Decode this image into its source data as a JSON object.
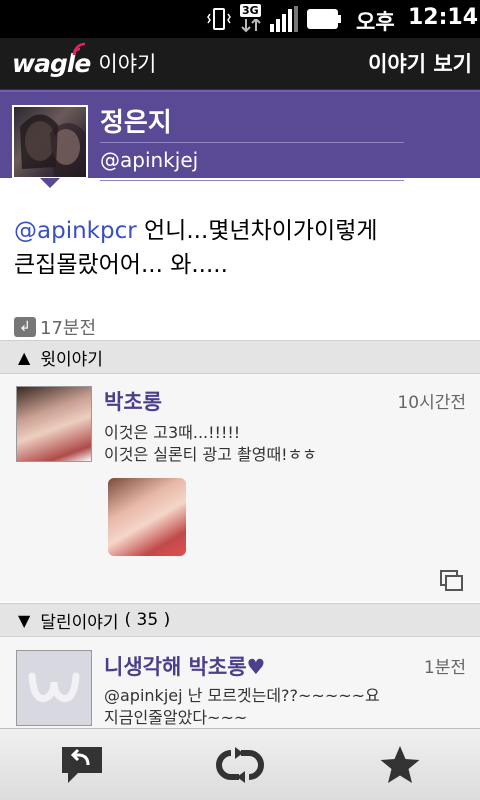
{
  "status_bar": {
    "network": "3G",
    "ampm": "오후",
    "time": "12:14"
  },
  "header": {
    "logo": "wagle",
    "logo_sub": "이야기",
    "action": "이야기 보기"
  },
  "profile": {
    "name": "정은지",
    "handle": "@apinkjej"
  },
  "post": {
    "mention": "@apinkpcr",
    "text_line1": " 언니...몇년차이가이렇게",
    "text_line2": "큰집몰랐어어... 와.....",
    "time": "17분전"
  },
  "sections": {
    "parent_label": "윗이야기",
    "replies_label": "달린이야기",
    "replies_count": "( 35 )"
  },
  "parent_story": {
    "name": "박초롱",
    "time": "10시간전",
    "line1": "이것은 고3때...!!!!!",
    "line2": "이것은 실론티 광고 촬영때!ㅎㅎ"
  },
  "reply_story": {
    "name": "니생각해 박초롱♥",
    "time": "1분전",
    "line1": "@apinkjej 난 모르겟는데??~~~~~요",
    "line2": "지금인줄알았다~~~"
  },
  "bottom_actions": [
    "reply",
    "rewagle",
    "favorite"
  ],
  "colors": {
    "accent": "#5a4a96",
    "mention": "#3a4fc2",
    "name": "#4b3f8c"
  }
}
